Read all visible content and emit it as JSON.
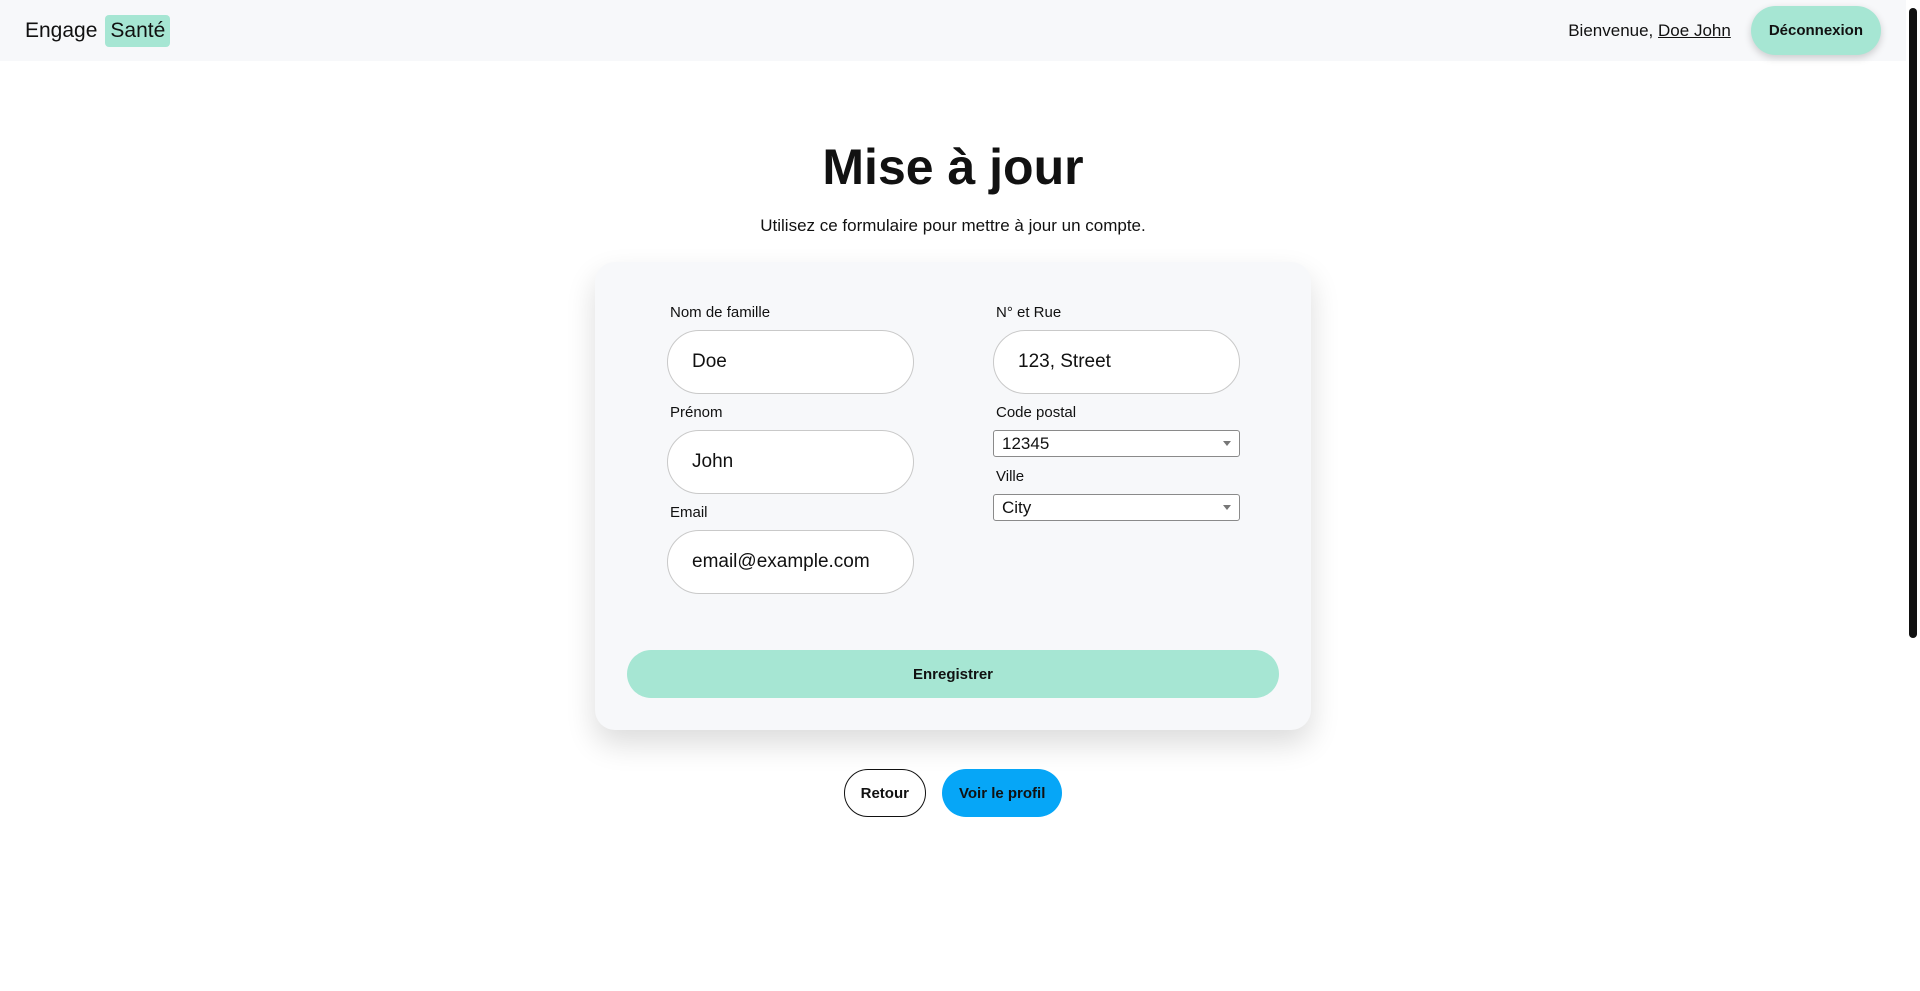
{
  "header": {
    "brand_primary": "Engage",
    "brand_accent": "Santé",
    "welcome_text": "Bienvenue,",
    "user_name": "Doe John",
    "logout_label": "Déconnexion"
  },
  "main": {
    "title": "Mise à jour",
    "subtitle": "Utilisez ce formulaire pour mettre à jour un compte."
  },
  "form": {
    "last_name": {
      "label": "Nom de famille",
      "value": "Doe"
    },
    "first_name": {
      "label": "Prénom",
      "value": "John"
    },
    "email": {
      "label": "Email",
      "value": "email@example.com"
    },
    "street": {
      "label": "N° et Rue",
      "value": "123, Street"
    },
    "postal_code": {
      "label": "Code postal",
      "value": "12345"
    },
    "city": {
      "label": "Ville",
      "value": "City"
    },
    "save_label": "Enregistrer"
  },
  "actions": {
    "back_label": "Retour",
    "profile_label": "Voir le profil"
  },
  "colors": {
    "accent": "#a6e6d3",
    "primary_blue": "#06a6f7",
    "card_bg": "#f7f8fa"
  },
  "icons": {
    "select_caret": "chevron-down-icon"
  }
}
